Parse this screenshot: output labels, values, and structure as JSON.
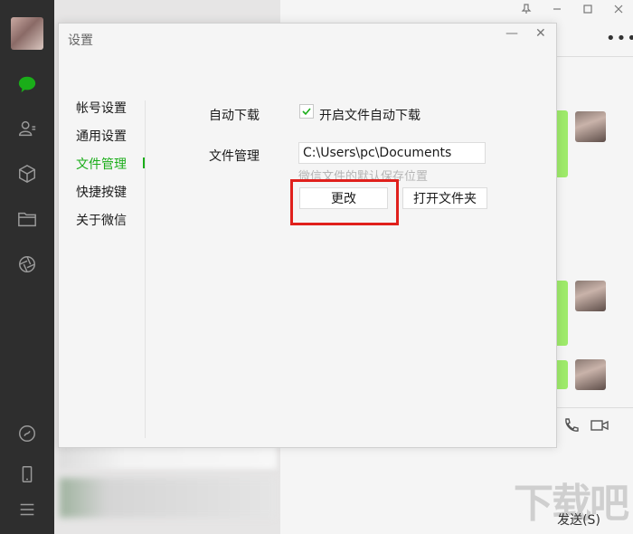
{
  "dialog": {
    "title": "设置",
    "minimize_glyph": "—",
    "close_glyph": "✕",
    "nav": [
      {
        "label": "帐号设置",
        "active": false
      },
      {
        "label": "通用设置",
        "active": false
      },
      {
        "label": "文件管理",
        "active": true
      },
      {
        "label": "快捷按键",
        "active": false
      },
      {
        "label": "关于微信",
        "active": false
      }
    ],
    "auto_download_label": "自动下载",
    "auto_download_checkbox_label": "开启文件自动下载",
    "auto_download_checked": true,
    "file_manage_label": "文件管理",
    "path_value": "C:\\Users\\pc\\Documents",
    "path_hint": "微信文件的默认保存位置",
    "change_button": "更改",
    "open_folder_button": "打开文件夹"
  },
  "chat": {
    "send_button": "发送(S)",
    "more_glyph": "•••"
  },
  "colors": {
    "accent": "#1aad19",
    "sidebar": "#2e2e2e",
    "highlight": "#e0201c",
    "bubble": "#9eea6a"
  },
  "sidebar_icons": [
    "chat-icon",
    "contacts-icon",
    "favorites-icon",
    "files-icon",
    "moments-icon",
    "miniprogram-icon",
    "phone-icon",
    "menu-icon"
  ],
  "watermark": "下载吧"
}
